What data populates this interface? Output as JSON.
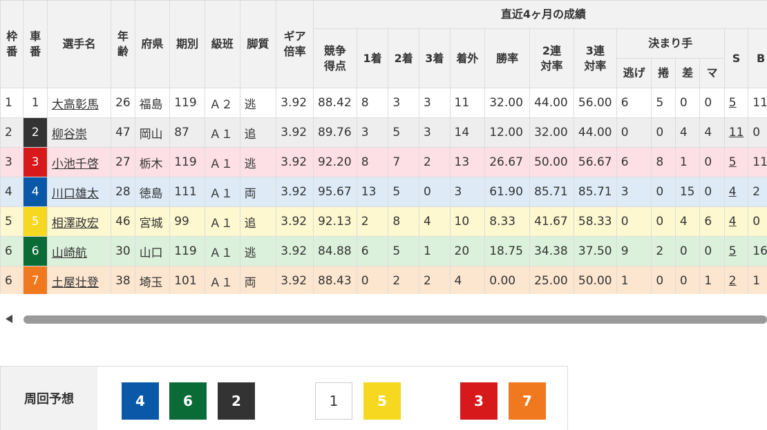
{
  "table": {
    "headers": {
      "waku": "枠番",
      "car": "車番",
      "name": "選手名",
      "age": "年齢",
      "pref": "府県",
      "term": "期別",
      "class": "級班",
      "style": "脚質",
      "gear": "ギア倍率",
      "recent_group": "直近4ヶ月の成績",
      "score": "競争得点",
      "first": "1着",
      "second": "2着",
      "third": "3着",
      "out": "着外",
      "winrate": "勝率",
      "ren2": "2連対率",
      "ren3": "3連対率",
      "kimarite_group": "決まり手",
      "nige": "逃げ",
      "makuri": "捲",
      "sashi": "差",
      "mark": "マ",
      "s": "S",
      "b": "B"
    },
    "rows": [
      {
        "waku": "1",
        "car": "1",
        "name": "大高彰馬",
        "age": "26",
        "pref": "福島",
        "term": "119",
        "class": "Ａ２",
        "style": "逃",
        "gear": "3.92",
        "score": "88.42",
        "first": "8",
        "second": "3",
        "third": "3",
        "out": "11",
        "winrate": "32.00",
        "ren2": "44.00",
        "ren3": "56.00",
        "nige": "6",
        "makuri": "5",
        "sashi": "0",
        "mark": "0",
        "s": "5",
        "b": "11"
      },
      {
        "waku": "2",
        "car": "2",
        "name": "柳谷崇",
        "age": "47",
        "pref": "岡山",
        "term": "87",
        "class": "Ａ１",
        "style": "追",
        "gear": "3.92",
        "score": "89.76",
        "first": "3",
        "second": "5",
        "third": "3",
        "out": "14",
        "winrate": "12.00",
        "ren2": "32.00",
        "ren3": "44.00",
        "nige": "0",
        "makuri": "0",
        "sashi": "4",
        "mark": "4",
        "s": "11",
        "b": "0"
      },
      {
        "waku": "3",
        "car": "3",
        "name": "小池千啓",
        "age": "27",
        "pref": "栃木",
        "term": "119",
        "class": "Ａ１",
        "style": "逃",
        "gear": "3.92",
        "score": "92.20",
        "first": "8",
        "second": "7",
        "third": "2",
        "out": "13",
        "winrate": "26.67",
        "ren2": "50.00",
        "ren3": "56.67",
        "nige": "6",
        "makuri": "8",
        "sashi": "1",
        "mark": "0",
        "s": "5",
        "b": "11"
      },
      {
        "waku": "4",
        "car": "4",
        "name": "川口雄太",
        "age": "28",
        "pref": "徳島",
        "term": "111",
        "class": "Ａ１",
        "style": "両",
        "gear": "3.92",
        "score": "95.67",
        "first": "13",
        "second": "5",
        "third": "0",
        "out": "3",
        "winrate": "61.90",
        "ren2": "85.71",
        "ren3": "85.71",
        "nige": "3",
        "makuri": "0",
        "sashi": "15",
        "mark": "0",
        "s": "4",
        "b": "2"
      },
      {
        "waku": "5",
        "car": "5",
        "name": "相澤政宏",
        "age": "46",
        "pref": "宮城",
        "term": "99",
        "class": "Ａ１",
        "style": "追",
        "gear": "3.92",
        "score": "92.13",
        "first": "2",
        "second": "8",
        "third": "4",
        "out": "10",
        "winrate": "8.33",
        "ren2": "41.67",
        "ren3": "58.33",
        "nige": "0",
        "makuri": "0",
        "sashi": "4",
        "mark": "6",
        "s": "4",
        "b": "0"
      },
      {
        "waku": "6",
        "car": "6",
        "name": "山崎航",
        "age": "30",
        "pref": "山口",
        "term": "119",
        "class": "Ａ１",
        "style": "逃",
        "gear": "3.92",
        "score": "84.88",
        "first": "6",
        "second": "5",
        "third": "1",
        "out": "20",
        "winrate": "18.75",
        "ren2": "34.38",
        "ren3": "37.50",
        "nige": "9",
        "makuri": "2",
        "sashi": "0",
        "mark": "0",
        "s": "5",
        "b": "16"
      },
      {
        "waku": "6",
        "car": "7",
        "name": "土屋壮登",
        "age": "38",
        "pref": "埼玉",
        "term": "101",
        "class": "Ａ１",
        "style": "両",
        "gear": "3.92",
        "score": "88.43",
        "first": "0",
        "second": "2",
        "third": "2",
        "out": "4",
        "winrate": "0.00",
        "ren2": "25.00",
        "ren3": "50.00",
        "nige": "1",
        "makuri": "0",
        "sashi": "0",
        "mark": "1",
        "s": "2",
        "b": "1"
      }
    ],
    "row_colors": [
      "#ffffff",
      "#eeeeee",
      "#fde0e6",
      "#deebf7",
      "#fdf8cf",
      "#dcf1dc",
      "#fde6cf"
    ],
    "car_colors": [
      {
        "bg": "#ffffff",
        "fg": "#333333"
      },
      {
        "bg": "#333333",
        "fg": "#ffffff"
      },
      {
        "bg": "#d7191c",
        "fg": "#ffffff"
      },
      {
        "bg": "#0a58a8",
        "fg": "#ffffff"
      },
      {
        "bg": "#f5d81f",
        "fg": "#ffffff"
      },
      {
        "bg": "#0a6b36",
        "fg": "#ffffff"
      },
      {
        "bg": "#f0781e",
        "fg": "#ffffff"
      }
    ]
  },
  "prediction": {
    "label": "周回予想",
    "chips": [
      {
        "num": "4",
        "bg": "#0a58a8",
        "fg": "#ffffff",
        "border": "#0a58a8"
      },
      {
        "num": "6",
        "bg": "#0a6b36",
        "fg": "#ffffff",
        "border": "#0a6b36"
      },
      {
        "num": "2",
        "bg": "#333333",
        "fg": "#ffffff",
        "border": "#333333"
      },
      {
        "num": "1",
        "bg": "#ffffff",
        "fg": "#333333",
        "border": "#cccccc"
      },
      {
        "num": "5",
        "bg": "#f5d81f",
        "fg": "#ffffff",
        "border": "#f5d81f"
      },
      {
        "num": "3",
        "bg": "#d7191c",
        "fg": "#ffffff",
        "border": "#d7191c"
      },
      {
        "num": "7",
        "bg": "#f0781e",
        "fg": "#ffffff",
        "border": "#f0781e"
      }
    ]
  }
}
